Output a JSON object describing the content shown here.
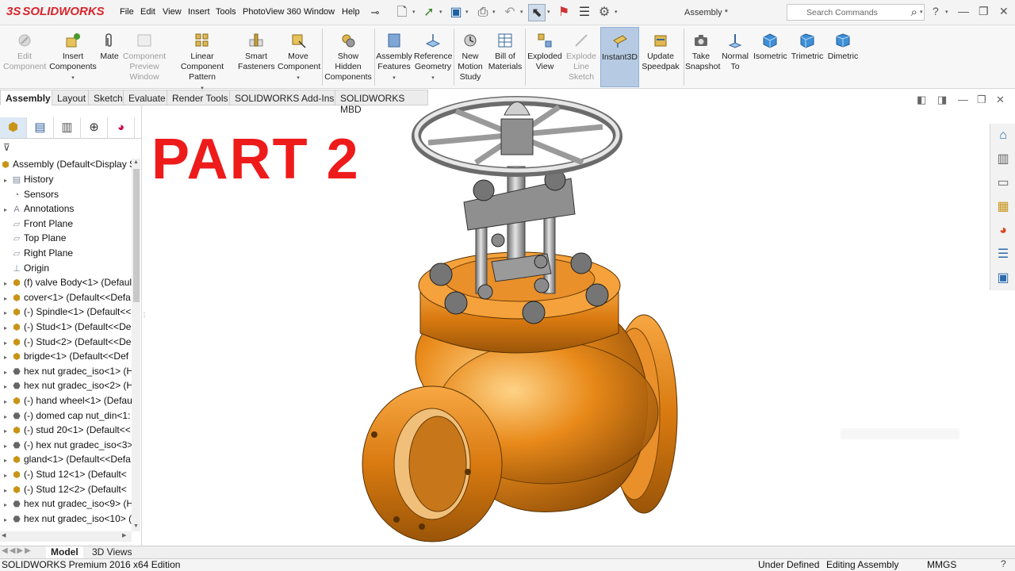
{
  "app": {
    "name": "SOLIDWORKS",
    "logo_mark": "3S"
  },
  "menu": [
    "File",
    "Edit",
    "View",
    "Insert",
    "Tools",
    "PhotoView 360",
    "Window",
    "Help"
  ],
  "document_title": "Assembly *",
  "search": {
    "placeholder": "Search Commands"
  },
  "ribbon": {
    "buttons": [
      {
        "id": "edit-component",
        "label": "Edit Component",
        "disabled": true
      },
      {
        "id": "insert-components",
        "label": "Insert Components",
        "disabled": false
      },
      {
        "id": "mate",
        "label": "Mate",
        "disabled": false
      },
      {
        "id": "component-preview-window",
        "label": "Component Preview Window",
        "disabled": true
      },
      {
        "id": "linear-component-pattern",
        "label": "Linear Component Pattern",
        "disabled": false
      },
      {
        "id": "smart-fasteners",
        "label": "Smart Fasteners",
        "disabled": false
      },
      {
        "id": "move-component",
        "label": "Move Component",
        "disabled": false
      },
      {
        "id": "show-hidden-components",
        "label": "Show Hidden Components",
        "disabled": false
      },
      {
        "id": "assembly-features",
        "label": "Assembly Features",
        "disabled": false
      },
      {
        "id": "reference-geometry",
        "label": "Reference Geometry",
        "disabled": false
      },
      {
        "id": "new-motion-study",
        "label": "New Motion Study",
        "disabled": false
      },
      {
        "id": "bill-of-materials",
        "label": "Bill of Materials",
        "disabled": false
      },
      {
        "id": "exploded-view",
        "label": "Exploded View",
        "disabled": false
      },
      {
        "id": "explode-line-sketch",
        "label": "Explode Line Sketch",
        "disabled": true
      },
      {
        "id": "instant3d",
        "label": "Instant3D",
        "disabled": false,
        "active": true
      },
      {
        "id": "update-speedpak",
        "label": "Update Speedpak",
        "disabled": false
      },
      {
        "id": "take-snapshot",
        "label": "Take Snapshot",
        "disabled": false
      },
      {
        "id": "normal-to",
        "label": "Normal To",
        "disabled": false
      },
      {
        "id": "isometric",
        "label": "Isometric",
        "disabled": false
      },
      {
        "id": "trimetric",
        "label": "Trimetric",
        "disabled": false
      },
      {
        "id": "dimetric",
        "label": "Dimetric",
        "disabled": false
      }
    ]
  },
  "tabs": [
    "Assembly",
    "Layout",
    "Sketch",
    "Evaluate",
    "Render Tools",
    "SOLIDWORKS Add-Ins",
    "SOLIDWORKS MBD"
  ],
  "active_tab": "Assembly",
  "tree": {
    "root": "Assembly  (Default<Display S",
    "items": [
      {
        "label": "History",
        "icon": "history-icon",
        "expandable": true
      },
      {
        "label": "Sensors",
        "icon": "sensors-icon",
        "expandable": false
      },
      {
        "label": "Annotations",
        "icon": "annotations-icon",
        "expandable": true
      },
      {
        "label": "Front Plane",
        "icon": "plane-icon",
        "expandable": false
      },
      {
        "label": "Top Plane",
        "icon": "plane-icon",
        "expandable": false
      },
      {
        "label": "Right Plane",
        "icon": "plane-icon",
        "expandable": false
      },
      {
        "label": "Origin",
        "icon": "origin-icon",
        "expandable": false
      },
      {
        "label": "(f) valve Body<1> (Default",
        "icon": "part-icon",
        "expandable": true
      },
      {
        "label": "cover<1> (Default<<Defa",
        "icon": "part-icon",
        "expandable": true
      },
      {
        "label": "(-) Spindle<1> (Default<<",
        "icon": "part-icon",
        "expandable": true
      },
      {
        "label": "(-) Stud<1> (Default<<De",
        "icon": "part-icon",
        "expandable": true
      },
      {
        "label": "(-) Stud<2> (Default<<De",
        "icon": "part-icon",
        "expandable": true
      },
      {
        "label": "brigde<1> (Default<<Def",
        "icon": "part-icon",
        "expandable": true
      },
      {
        "label": "hex nut gradec_iso<1> (H",
        "icon": "bolt-icon",
        "expandable": true
      },
      {
        "label": "hex nut gradec_iso<2> (H",
        "icon": "bolt-icon",
        "expandable": true
      },
      {
        "label": "(-) hand wheel<1> (Defau",
        "icon": "part-icon",
        "expandable": true
      },
      {
        "label": "(-) domed cap nut_din<1:",
        "icon": "bolt-icon",
        "expandable": true
      },
      {
        "label": "(-) stud 20<1> (Default<<",
        "icon": "part-icon",
        "expandable": true
      },
      {
        "label": "(-) hex nut gradec_iso<3>",
        "icon": "bolt-icon",
        "expandable": true
      },
      {
        "label": "gland<1> (Default<<Defa",
        "icon": "part-icon",
        "expandable": true
      },
      {
        "label": "(-) Stud 12<1> (Default<",
        "icon": "part-icon",
        "expandable": true
      },
      {
        "label": "(-) Stud 12<2> (Default<",
        "icon": "part-icon",
        "expandable": true
      },
      {
        "label": "hex nut gradec_iso<9> (H",
        "icon": "bolt-icon",
        "expandable": true
      },
      {
        "label": "hex nut gradec_iso<10> (",
        "icon": "bolt-icon",
        "expandable": true
      }
    ]
  },
  "overlay_title": "PART 2",
  "bottom_tabs": [
    "Model",
    "3D Views"
  ],
  "status": {
    "edition": "SOLIDWORKS Premium 2016 x64 Edition",
    "state": "Under Defined",
    "mode": "Editing Assembly",
    "units": "MMGS"
  },
  "colors": {
    "accent": "#d8242b",
    "overlay": "#ee1b1b",
    "valve": "#e98a1a"
  }
}
